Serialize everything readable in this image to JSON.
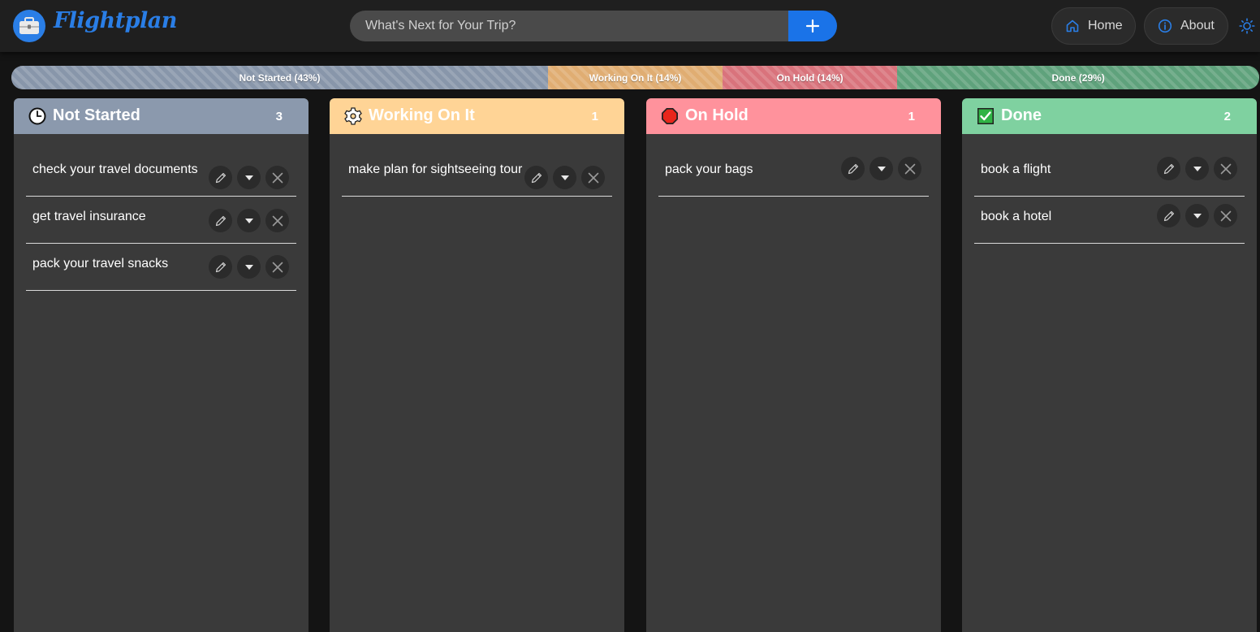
{
  "app": {
    "title": "Flightplan"
  },
  "icons": {
    "logo": "briefcase-icon",
    "add": "plus-icon",
    "home": "home-icon",
    "about": "info-icon",
    "theme": "sun-icon",
    "edit": "pencil-icon",
    "move": "caret-down-icon",
    "delete": "close-icon"
  },
  "search": {
    "placeholder": "What's Next for Your Trip?",
    "value": ""
  },
  "nav": {
    "home_label": "Home",
    "about_label": "About"
  },
  "colors": {
    "accent": "#1a73e8",
    "not_started": "#8b99ad",
    "working": "#ffd496",
    "on_hold": "#ff929c",
    "done": "#7fd1a0"
  },
  "progress": [
    {
      "label": "Not Started (43%)",
      "percent": 43,
      "color": "#8896aa"
    },
    {
      "label": "Working On It (14%)",
      "percent": 14,
      "color": "#e0ad72"
    },
    {
      "label": "On Hold (14%)",
      "percent": 14,
      "color": "#d9737c"
    },
    {
      "label": "Done (29%)",
      "percent": 29,
      "color": "#5fa27c"
    }
  ],
  "columns": [
    {
      "title": "Not Started",
      "count": "3",
      "icon": "clock-icon",
      "tasks": [
        "check your travel documents",
        "get travel insurance",
        "pack your travel snacks"
      ]
    },
    {
      "title": "Working On It",
      "count": "1",
      "icon": "gear-icon",
      "tasks": [
        "make plan for sightseeing tour"
      ]
    },
    {
      "title": "On Hold",
      "count": "1",
      "icon": "stop-sign-icon",
      "tasks": [
        "pack your bags"
      ]
    },
    {
      "title": "Done",
      "count": "2",
      "icon": "check-box-icon",
      "tasks": [
        "book a flight",
        "book a hotel"
      ]
    }
  ]
}
